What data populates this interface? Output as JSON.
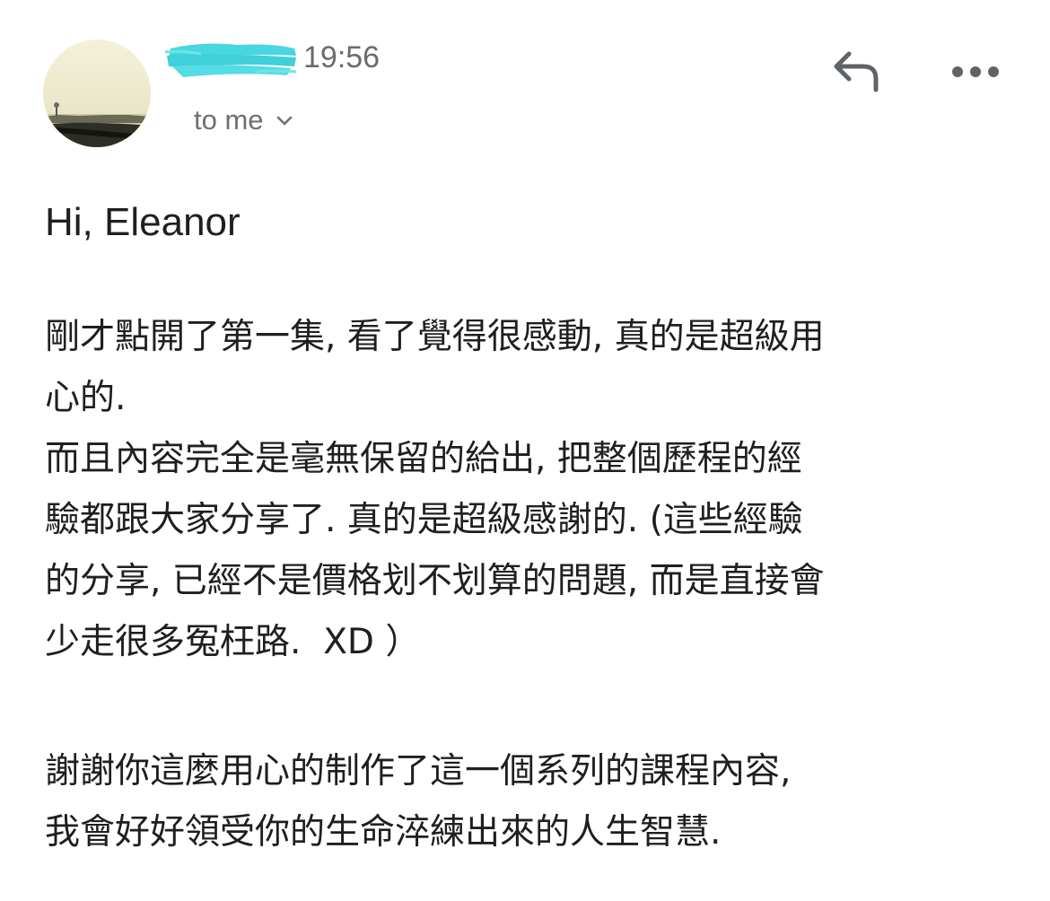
{
  "email": {
    "sender": {
      "avatar": "avatar-landscape-photo",
      "name_redacted": true
    },
    "time": "19:56",
    "recipient_label": "to me",
    "icons": {
      "recipient_toggle": "chevron-down-icon",
      "reply": "reply-icon",
      "more": "more-horizontal-icon"
    },
    "colors": {
      "redaction": "#48d6df",
      "text": "#1f1f1f",
      "secondary_text": "#6b6b6b"
    }
  },
  "message": {
    "greeting": "Hi, Eleanor",
    "paragraphs": [
      "剛才點開了第一集, 看了覺得很感動, 真的是超級用\n心的.",
      "而且內容完全是毫無保留的給出, 把整個歷程的經\n驗都跟大家分享了. 真的是超級感謝的. (這些經驗\n的分享, 已經不是價格划不划算的問題, 而是直接會\n少走很多冤枉路.  XD ）",
      "謝謝你這麼用心的制作了這一個系列的課程內容,\n我會好好領受你的生命淬練出來的人生智慧."
    ]
  }
}
